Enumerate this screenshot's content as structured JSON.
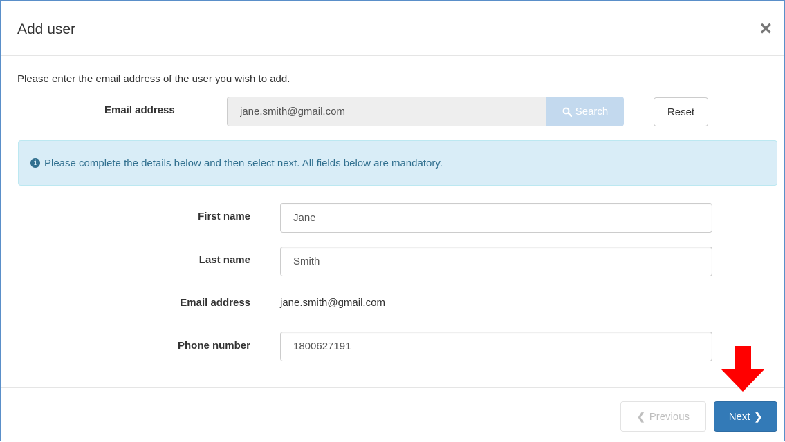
{
  "dialog": {
    "title": "Add user",
    "close_label": "×"
  },
  "intro_text": "Please enter the email address of the user you wish to add.",
  "search": {
    "label": "Email address",
    "value": "jane.smith@gmail.com",
    "button_label": "Search",
    "button_icon": "search-icon",
    "reset_label": "Reset"
  },
  "alert": {
    "icon": "info-icon",
    "text": "Please complete the details below and then select next. All fields below are mandatory."
  },
  "form": {
    "first_name": {
      "label": "First name",
      "value": "Jane"
    },
    "last_name": {
      "label": "Last name",
      "value": "Smith"
    },
    "email": {
      "label": "Email address",
      "value": "jane.smith@gmail.com"
    },
    "phone": {
      "label": "Phone number",
      "value": "1800627191"
    }
  },
  "footer": {
    "previous_label": "Previous",
    "next_label": "Next"
  },
  "colors": {
    "primary": "#337ab7",
    "alert_bg": "#d9edf7",
    "alert_text": "#31708f",
    "annotation_arrow": "#ff0000"
  }
}
